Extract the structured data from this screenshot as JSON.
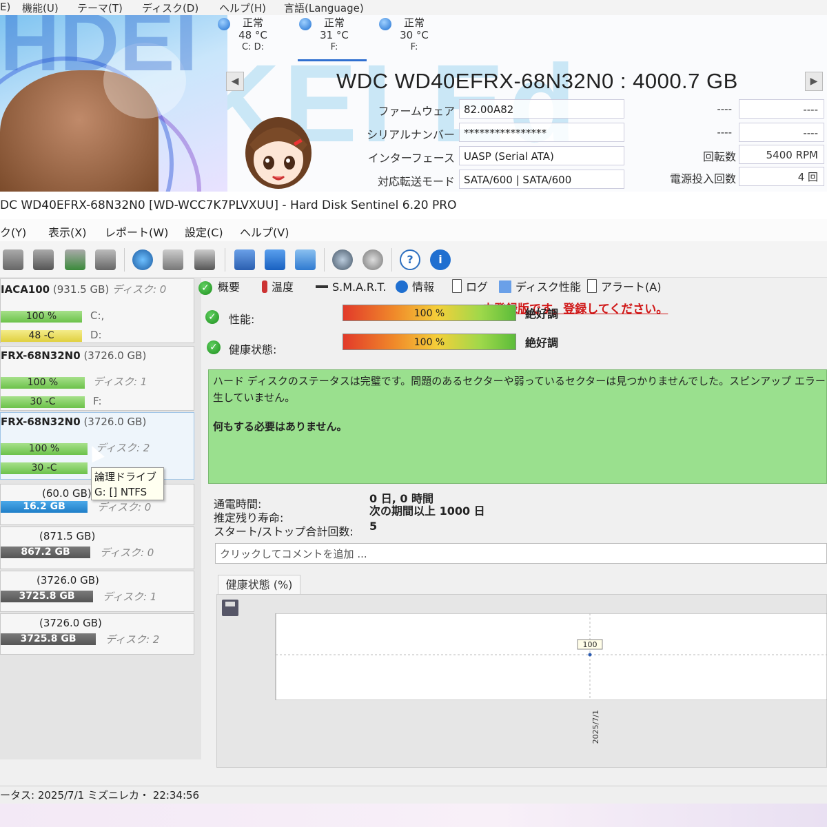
{
  "cdi": {
    "menu": [
      "E)",
      "機能(U)",
      "テーマ(T)",
      "ディスク(D)",
      "ヘルプ(H)",
      "言語(Language)"
    ],
    "drives": [
      {
        "status": "正常",
        "temp": "48 °C",
        "letters": "C: D:"
      },
      {
        "status": "正常",
        "temp": "31 °C",
        "letters": "F:"
      },
      {
        "status": "正常",
        "temp": "30 °C",
        "letters": "F:"
      }
    ],
    "model": "WDC WD40EFRX-68N32N0 : 4000.7 GB",
    "nav_left": "◀",
    "nav_right": "▶",
    "fields": [
      {
        "label": "ファームウェア",
        "value": "82.00A82"
      },
      {
        "label": "シリアルナンバー",
        "value": "****************"
      },
      {
        "label": "インターフェース",
        "value": "UASP (Serial ATA)"
      },
      {
        "label": "対応転送モード",
        "value": "SATA/600 | SATA/600"
      }
    ],
    "right_fields": [
      {
        "label": "",
        "value": "----",
        "value2": "----"
      },
      {
        "label": "",
        "value": "----",
        "value2": "----"
      },
      {
        "label": "回転数",
        "value": "5400 RPM"
      },
      {
        "label": "電源投入回数",
        "value": "4 回"
      }
    ],
    "banner_text": "HDEI KEI Edition",
    "colors": {
      "accent": "#2f6fd0",
      "good": "#9ae08e"
    }
  },
  "hds": {
    "title": "DC WD40EFRX-68N32N0 [WD-WCC7K7PLVXUU]  -  Hard Disk Sentinel 6.20 PRO",
    "menu": [
      "ク(Y)",
      "表示(X)",
      "レポート(W)",
      "設定(C)",
      "ヘルプ(V)"
    ],
    "unregistered": "未登録版です。登録してください。",
    "toolbar_icons": [
      "disk-icon",
      "disk-clock-icon",
      "disk-check-icon",
      "disk-search-icon",
      "globe-disk-icon",
      "disks-icon",
      "disk-export-icon",
      "notepad-icon",
      "mail-icon",
      "network-icon",
      "gear-icon",
      "speaker-icon",
      "help-icon",
      "info-icon"
    ],
    "disks": [
      {
        "name": "IACA100",
        "size": "(931.5 GB)",
        "disk": "ディスク: 0",
        "health": "100 %",
        "temp": "48 -C",
        "letter1": "C:,",
        "letter2": "D:"
      },
      {
        "name": "FRX-68N32N0",
        "size": "(3726.0 GB)",
        "disk": "ディスク: 1",
        "health": "100 %",
        "temp": "30 -C",
        "letter2": "F:"
      },
      {
        "name": "FRX-68N32N0",
        "size": "(3726.0 GB)",
        "disk": "ディスク: 2",
        "health": "100 %",
        "temp": "30 -C"
      }
    ],
    "volumes": [
      {
        "size": "(60.0 GB)",
        "free": "16.2 GB",
        "disk": "ディスク: 0"
      },
      {
        "size": "(871.5 GB)",
        "free": "867.2 GB",
        "disk": "ディスク: 0"
      },
      {
        "size": "(3726.0 GB)",
        "free": "3725.8 GB",
        "disk": "ディスク: 1"
      },
      {
        "size": "(3726.0 GB)",
        "free": "3725.8 GB",
        "disk": "ディスク: 2"
      }
    ],
    "tooltip": {
      "line1": "論理ドライブ",
      "line2": "G: [] NTFS"
    },
    "tabs": [
      "概要",
      "温度",
      "S.M.A.R.T.",
      "情報",
      "ログ",
      "ディスク性能",
      "アラート(A)"
    ],
    "performance": {
      "label": "性能:",
      "value": "100 %",
      "result": "絶好調",
      "fraction": 1.0
    },
    "health": {
      "label": "健康状態:",
      "value": "100 %",
      "result": "絶好調",
      "fraction": 1.0
    },
    "status_message_1": "ハード ディスクのステータスは完璧です。問題のあるセクターや弱っているセクターは見つかりませんでした。スピンアップ エラーとデータ",
    "status_message_2": "生していません。",
    "status_action": "何もする必要はありません。",
    "info": [
      {
        "key": "通電時間:",
        "value": "0 日, 0 時間"
      },
      {
        "key": "推定残り寿命:",
        "value": "次の期間以上 1000 日"
      },
      {
        "key": "スタート/ストップ合計回数:",
        "value": "5"
      }
    ],
    "comment_placeholder": "クリックしてコメントを追加 ...",
    "chart_tab": "健康状態 (%)",
    "status_bar": "ータス: 2025/7/1 ミズニレカ・ 22:34:56"
  },
  "chart_data": {
    "type": "line",
    "title": "健康状態 (%)",
    "x": [
      "2025/7/1"
    ],
    "series": [
      {
        "values": [
          100
        ]
      }
    ],
    "ytick": "100",
    "data_label": "100"
  }
}
